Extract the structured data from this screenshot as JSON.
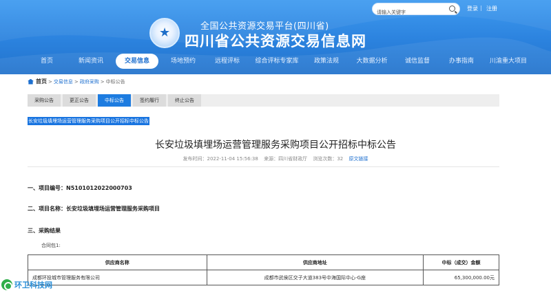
{
  "header": {
    "subtitle": "全国公共资源交易平台(四川省)",
    "title": "四川省公共资源交易信息网",
    "search_placeholder": "请输入关键字",
    "login": "登录",
    "separator": "|",
    "register": "注册"
  },
  "nav": {
    "items": [
      {
        "label": "首页"
      },
      {
        "label": "新闻资讯"
      },
      {
        "label": "交易信息"
      },
      {
        "label": "场地预约"
      },
      {
        "label": "远程评标"
      },
      {
        "label": "综合评标专家库"
      },
      {
        "label": "政策法规"
      },
      {
        "label": "大数据分析"
      },
      {
        "label": "诚信监督"
      },
      {
        "label": "办事指南"
      },
      {
        "label": "川渝重大项目"
      }
    ],
    "active_index": 2
  },
  "breadcrumb": {
    "home": "首页",
    "sep": ">",
    "trade": "交易信息",
    "gov": "政府采购",
    "current": "中标公告"
  },
  "tabs": [
    "采购公告",
    "更正公告",
    "中标公告",
    "签约履行",
    "终止公告"
  ],
  "selected_title": "长安垃圾填埋场运营管理服务采购项目公开招标中标公告",
  "article": {
    "title": "长安垃圾填埋场运营管理服务采购项目公开招标中标公告",
    "meta_time": "发布时间：2022-11-04 15:56:38",
    "meta_source": "来源：四川省财政厅",
    "meta_views": "浏览次数：32",
    "meta_link": "原文链接",
    "section1": "一、项目编号：N5101012022000703",
    "section2": "二、项目名称：长安垃圾填埋场运营管理服务采购项目",
    "section3": "三、采购结果",
    "package": "合同包1:"
  },
  "table": {
    "headers": [
      "供应商名称",
      "供应商地址",
      "中标（成交）金额"
    ],
    "rows": [
      [
        "成都环投城市管理服务有限公司",
        "成都市武侯区交子大道383号中海国际中心-G座",
        "65,300,000.00元"
      ]
    ]
  },
  "watermark": {
    "text": "环卫科技网"
  },
  "colors": {
    "header_blue": "#2b82de",
    "accent": "#1d7ce0",
    "watermark_green": "#2fae4a"
  }
}
